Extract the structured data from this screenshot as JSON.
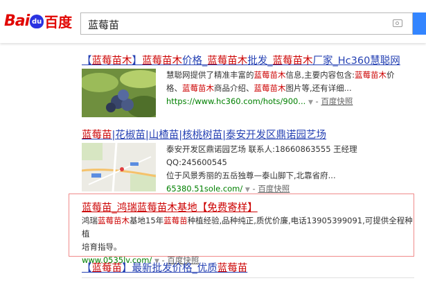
{
  "header": {
    "logo_bai": "Bai",
    "logo_du": "百度",
    "search_value": "蓝莓苗"
  },
  "results": [
    {
      "title_parts": [
        "【",
        "蓝莓苗木",
        "】",
        "蓝莓苗木",
        "价格_",
        "蓝莓苗木",
        "批发_",
        "蓝莓苗木",
        "厂家_Hc360慧聪网"
      ],
      "abstract_line1_parts": [
        "慧聪网提供了精准丰富的",
        "蓝莓苗木",
        "信息,主要内容包含:",
        "蓝莓苗木",
        "价"
      ],
      "abstract_line2_parts": [
        "格、",
        "蓝莓苗木",
        "商品介绍、",
        "蓝莓苗木",
        "图片等,还有详细..."
      ],
      "url": "https://www.hc360.com/hots/900...",
      "snapshot": "百度快照"
    },
    {
      "title_parts": [
        "蓝莓苗",
        "|花椒苗|山楂苗|核桃树苗|泰安开发区鼎诺园艺场"
      ],
      "abstract_line1": "泰安开发区鼎诺园艺场 联系人:18660863555 王经理 QQ:245600545",
      "abstract_line2": "位于风景秀丽的五岳独尊—泰山脚下,北靠省府...",
      "url": "65380.51sole.com/",
      "snapshot": "百度快照"
    },
    {
      "title_parts": [
        "蓝莓苗",
        "_鸿瑞",
        "蓝莓苗木",
        "基地【免费寄样】"
      ],
      "abstract_line1_parts": [
        "鸿瑞",
        "蓝莓苗木",
        "基地15年",
        "蓝莓苗",
        "种植经验,品种纯正,质优价廉,电话13905399091,可提供全程种植"
      ],
      "abstract_line2": "培育指导。",
      "url": "www.0535lv.com/",
      "snapshot": "百度快照"
    },
    {
      "title_parts": [
        "【",
        "蓝莓苗",
        "】最新批发价格_优质",
        "蓝莓苗"
      ]
    }
  ]
}
